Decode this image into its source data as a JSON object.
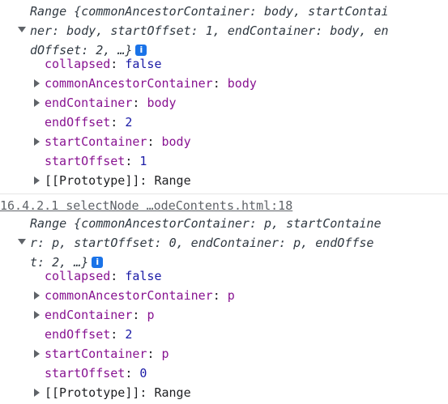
{
  "log1": {
    "summary_lines": [
      "Range {commonAncestorContainer: body, startContai",
      "ner: body, startOffset: 1, endContainer: body, en",
      "dOffset: 2, …}"
    ],
    "props": [
      {
        "key": "collapsed",
        "value": "false",
        "type": "bool",
        "expandable": false
      },
      {
        "key": "commonAncestorContainer",
        "value": "body",
        "type": "node",
        "expandable": true
      },
      {
        "key": "endContainer",
        "value": "body",
        "type": "node",
        "expandable": true
      },
      {
        "key": "endOffset",
        "value": "2",
        "type": "num",
        "expandable": false
      },
      {
        "key": "startContainer",
        "value": "body",
        "type": "node",
        "expandable": true
      },
      {
        "key": "startOffset",
        "value": "1",
        "type": "num",
        "expandable": false
      },
      {
        "key": "[[Prototype]]",
        "value": "Range",
        "type": "proto",
        "expandable": true
      }
    ]
  },
  "log2": {
    "source_link": "16.4.2.1 selectNode …odeContents.html:18",
    "summary_lines": [
      "Range {commonAncestorContainer: p, startContaine",
      "r: p, startOffset: 0, endContainer: p, endOffse",
      "t: 2, …}"
    ],
    "props": [
      {
        "key": "collapsed",
        "value": "false",
        "type": "bool",
        "expandable": false
      },
      {
        "key": "commonAncestorContainer",
        "value": "p",
        "type": "node",
        "expandable": true
      },
      {
        "key": "endContainer",
        "value": "p",
        "type": "node",
        "expandable": true
      },
      {
        "key": "endOffset",
        "value": "2",
        "type": "num",
        "expandable": false
      },
      {
        "key": "startContainer",
        "value": "p",
        "type": "node",
        "expandable": true
      },
      {
        "key": "startOffset",
        "value": "0",
        "type": "num",
        "expandable": false
      },
      {
        "key": "[[Prototype]]",
        "value": "Range",
        "type": "proto",
        "expandable": true
      }
    ]
  },
  "info_icon": "i",
  "colors": {
    "key": "#881391",
    "number": "#1a1aa6",
    "info": "#1a73e8"
  }
}
